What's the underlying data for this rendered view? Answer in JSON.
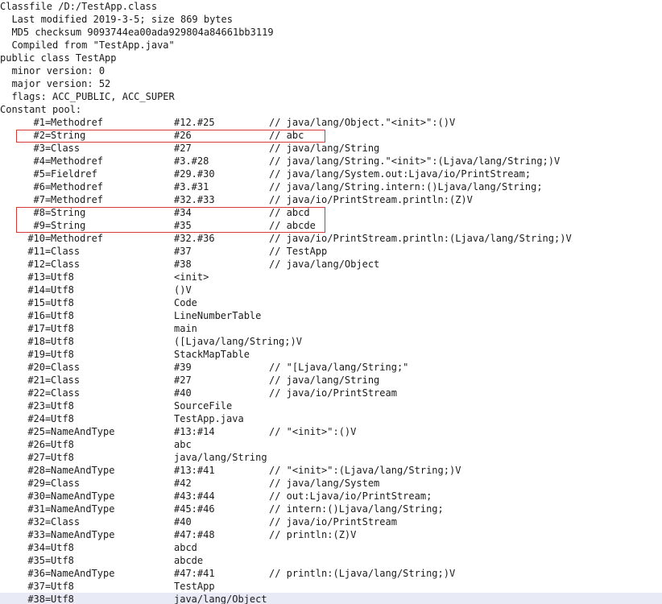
{
  "header": {
    "lines": [
      "Classfile /D:/TestApp.class",
      "  Last modified 2019-3-5; size 869 bytes",
      "  MD5 checksum 9093744ea00ada929804a84661bb3119",
      "  Compiled from \"TestApp.java\"",
      "public class TestApp",
      "  minor version: 0",
      "  major version: 52",
      "  flags: ACC_PUBLIC, ACC_SUPER",
      "Constant pool:"
    ]
  },
  "constant_pool": [
    {
      "idx": "#1",
      "type": "Methodref",
      "ref": "#12.#25",
      "comment": "// java/lang/Object.\"<init>\":()V"
    },
    {
      "idx": "#2",
      "type": "String",
      "ref": "#26",
      "comment": "// abc"
    },
    {
      "idx": "#3",
      "type": "Class",
      "ref": "#27",
      "comment": "// java/lang/String"
    },
    {
      "idx": "#4",
      "type": "Methodref",
      "ref": "#3.#28",
      "comment": "// java/lang/String.\"<init>\":(Ljava/lang/String;)V"
    },
    {
      "idx": "#5",
      "type": "Fieldref",
      "ref": "#29.#30",
      "comment": "// java/lang/System.out:Ljava/io/PrintStream;"
    },
    {
      "idx": "#6",
      "type": "Methodref",
      "ref": "#3.#31",
      "comment": "// java/lang/String.intern:()Ljava/lang/String;"
    },
    {
      "idx": "#7",
      "type": "Methodref",
      "ref": "#32.#33",
      "comment": "// java/io/PrintStream.println:(Z)V"
    },
    {
      "idx": "#8",
      "type": "String",
      "ref": "#34",
      "comment": "// abcd"
    },
    {
      "idx": "#9",
      "type": "String",
      "ref": "#35",
      "comment": "// abcde"
    },
    {
      "idx": "#10",
      "type": "Methodref",
      "ref": "#32.#36",
      "comment": "// java/io/PrintStream.println:(Ljava/lang/String;)V"
    },
    {
      "idx": "#11",
      "type": "Class",
      "ref": "#37",
      "comment": "// TestApp"
    },
    {
      "idx": "#12",
      "type": "Class",
      "ref": "#38",
      "comment": "// java/lang/Object"
    },
    {
      "idx": "#13",
      "type": "Utf8",
      "ref": "<init>",
      "comment": ""
    },
    {
      "idx": "#14",
      "type": "Utf8",
      "ref": "()V",
      "comment": ""
    },
    {
      "idx": "#15",
      "type": "Utf8",
      "ref": "Code",
      "comment": ""
    },
    {
      "idx": "#16",
      "type": "Utf8",
      "ref": "LineNumberTable",
      "comment": ""
    },
    {
      "idx": "#17",
      "type": "Utf8",
      "ref": "main",
      "comment": ""
    },
    {
      "idx": "#18",
      "type": "Utf8",
      "ref": "([Ljava/lang/String;)V",
      "comment": ""
    },
    {
      "idx": "#19",
      "type": "Utf8",
      "ref": "StackMapTable",
      "comment": ""
    },
    {
      "idx": "#20",
      "type": "Class",
      "ref": "#39",
      "comment": "// \"[Ljava/lang/String;\""
    },
    {
      "idx": "#21",
      "type": "Class",
      "ref": "#27",
      "comment": "// java/lang/String"
    },
    {
      "idx": "#22",
      "type": "Class",
      "ref": "#40",
      "comment": "// java/io/PrintStream"
    },
    {
      "idx": "#23",
      "type": "Utf8",
      "ref": "SourceFile",
      "comment": ""
    },
    {
      "idx": "#24",
      "type": "Utf8",
      "ref": "TestApp.java",
      "comment": ""
    },
    {
      "idx": "#25",
      "type": "NameAndType",
      "ref": "#13:#14",
      "comment": "// \"<init>\":()V"
    },
    {
      "idx": "#26",
      "type": "Utf8",
      "ref": "abc",
      "comment": ""
    },
    {
      "idx": "#27",
      "type": "Utf8",
      "ref": "java/lang/String",
      "comment": ""
    },
    {
      "idx": "#28",
      "type": "NameAndType",
      "ref": "#13:#41",
      "comment": "// \"<init>\":(Ljava/lang/String;)V"
    },
    {
      "idx": "#29",
      "type": "Class",
      "ref": "#42",
      "comment": "// java/lang/System"
    },
    {
      "idx": "#30",
      "type": "NameAndType",
      "ref": "#43:#44",
      "comment": "// out:Ljava/io/PrintStream;"
    },
    {
      "idx": "#31",
      "type": "NameAndType",
      "ref": "#45:#46",
      "comment": "// intern:()Ljava/lang/String;"
    },
    {
      "idx": "#32",
      "type": "Class",
      "ref": "#40",
      "comment": "// java/io/PrintStream"
    },
    {
      "idx": "#33",
      "type": "NameAndType",
      "ref": "#47:#48",
      "comment": "// println:(Z)V"
    },
    {
      "idx": "#34",
      "type": "Utf8",
      "ref": "abcd",
      "comment": ""
    },
    {
      "idx": "#35",
      "type": "Utf8",
      "ref": "abcde",
      "comment": ""
    },
    {
      "idx": "#36",
      "type": "NameAndType",
      "ref": "#47:#41",
      "comment": "// println:(Ljava/lang/String;)V"
    },
    {
      "idx": "#37",
      "type": "Utf8",
      "ref": "TestApp",
      "comment": ""
    },
    {
      "idx": "#38",
      "type": "Utf8",
      "ref": "java/lang/Object",
      "comment": ""
    }
  ],
  "highlighted_entries": [
    "#2",
    "#8",
    "#9"
  ],
  "selected_entry": "#38",
  "colors": {
    "text": "#1a1a1a",
    "highlight_border": "#d43a3a",
    "selected_row_bg": "#e8ebf5"
  }
}
